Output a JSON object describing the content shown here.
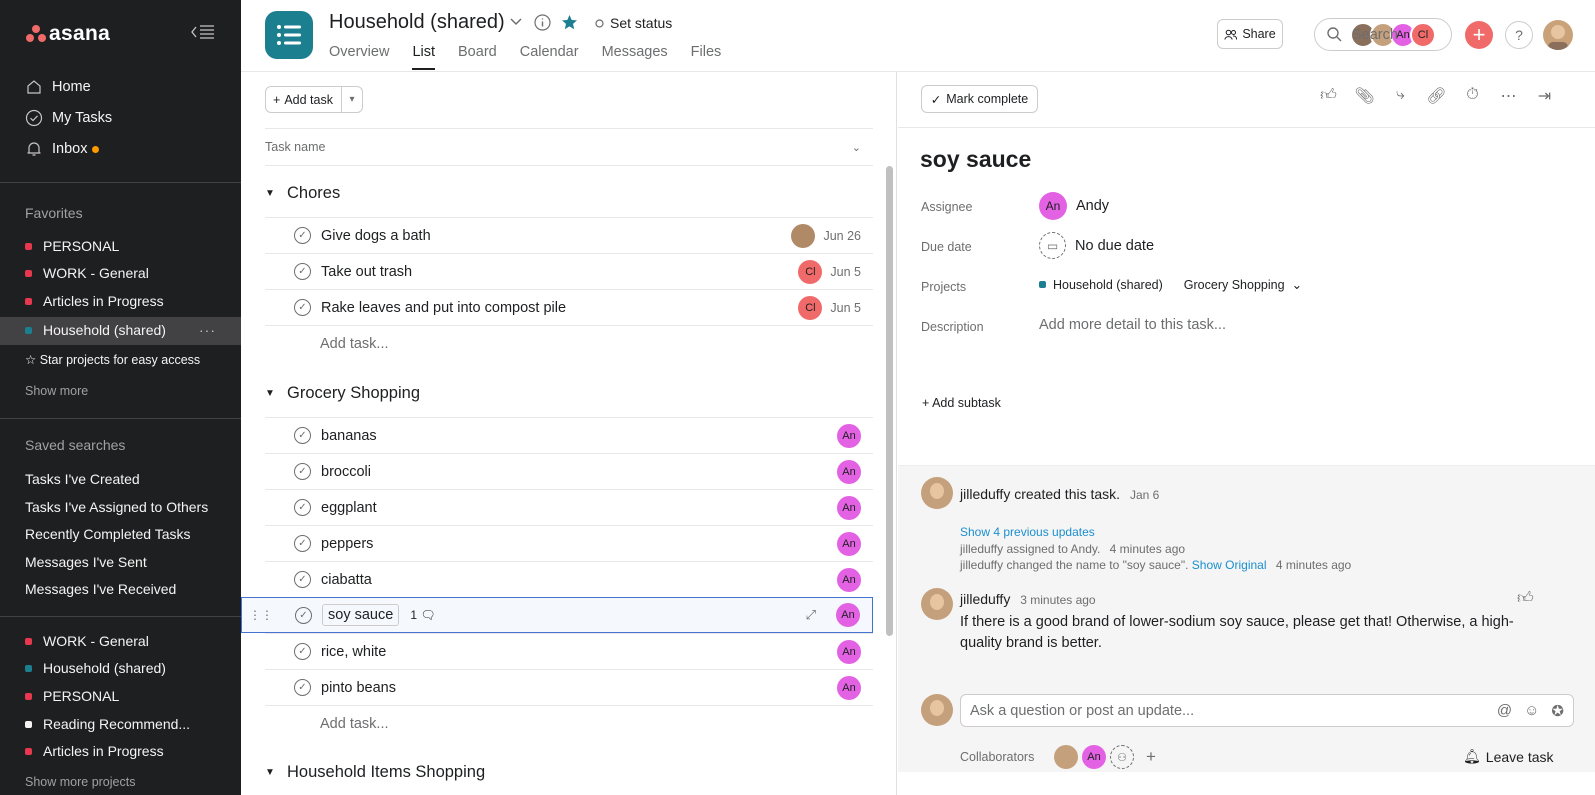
{
  "app": {
    "logo": "asana"
  },
  "sidebar": {
    "nav": [
      {
        "label": "Home",
        "icon": "home-icon"
      },
      {
        "label": "My Tasks",
        "icon": "check-circle-icon"
      },
      {
        "label": "Inbox",
        "icon": "bell-icon"
      }
    ],
    "favorites_title": "Favorites",
    "favorites": [
      {
        "label": "PERSONAL",
        "color": "#e8384f"
      },
      {
        "label": "WORK - General",
        "color": "#e8384f"
      },
      {
        "label": "Articles in Progress",
        "color": "#e8384f"
      },
      {
        "label": "Household (shared)",
        "color": "#1c7f8f"
      }
    ],
    "star_hint": "Star projects for easy access",
    "show_more": "Show more",
    "saved_title": "Saved searches",
    "saved": [
      "Tasks I've Created",
      "Tasks I've Assigned to Others",
      "Recently Completed Tasks",
      "Messages I've Sent",
      "Messages I've Received"
    ],
    "projects": [
      {
        "label": "WORK - General",
        "color": "#e8384f"
      },
      {
        "label": "Household (shared)",
        "color": "#1c7f8f"
      },
      {
        "label": "PERSONAL",
        "color": "#e8384f"
      },
      {
        "label": "Reading Recommend...",
        "color": "#f5f4f3"
      },
      {
        "label": "Articles in Progress",
        "color": "#e8384f"
      }
    ],
    "show_more_projects": "Show more projects"
  },
  "header": {
    "title": "Household (shared)",
    "set_status": "Set status",
    "tabs": [
      "Overview",
      "List",
      "Board",
      "Calendar",
      "Messages",
      "Files"
    ],
    "active_tab": "List",
    "members": [
      "An",
      "Cl"
    ],
    "share": "Share",
    "search_placeholder": "Search",
    "help": "?"
  },
  "list": {
    "add_task": "Add task",
    "column_header": "Task name",
    "sections": [
      {
        "title": "Chores",
        "tasks": [
          {
            "name": "Give dogs a bath",
            "assignee": "",
            "due": "Jun 26"
          },
          {
            "name": "Take out trash",
            "assignee": "Cl",
            "due": "Jun 5"
          },
          {
            "name": "Rake leaves and put into compost pile",
            "assignee": "Cl",
            "due": "Jun 5"
          }
        ]
      },
      {
        "title": "Grocery Shopping",
        "tasks": [
          {
            "name": "bananas",
            "assignee": "An"
          },
          {
            "name": "broccoli",
            "assignee": "An"
          },
          {
            "name": "eggplant",
            "assignee": "An"
          },
          {
            "name": "peppers",
            "assignee": "An"
          },
          {
            "name": "ciabatta",
            "assignee": "An"
          },
          {
            "name": "soy sauce",
            "assignee": "An",
            "comments": "1"
          },
          {
            "name": "rice, white",
            "assignee": "An"
          },
          {
            "name": "pinto beans",
            "assignee": "An"
          }
        ]
      },
      {
        "title": "Household Items Shopping",
        "tasks": []
      }
    ],
    "add_task_row": "Add task..."
  },
  "detail": {
    "mark_complete": "Mark complete",
    "title": "soy sauce",
    "fields": {
      "assignee_label": "Assignee",
      "assignee_initials": "An",
      "assignee_name": "Andy",
      "due_label": "Due date",
      "due_value": "No due date",
      "projects_label": "Projects",
      "project_name": "Household (shared)",
      "project_section": "Grocery Shopping",
      "description_label": "Description",
      "description_placeholder": "Add more detail to this task..."
    },
    "add_subtask": "Add subtask",
    "activity": {
      "created_by": "jilleduffy created this task.",
      "created_date": "Jan 6",
      "show_previous": "Show 4 previous updates",
      "update1_user": "jilleduffy",
      "update1_text": "assigned to Andy.",
      "update1_time": "4 minutes ago",
      "update2_user": "jilleduffy",
      "update2_text": "changed the name to \"soy sauce\".",
      "update2_link": "Show Original",
      "update2_time": "4 minutes ago",
      "comment_user": "jilleduffy",
      "comment_time": "3 minutes ago",
      "comment_text": "If there is a good brand of lower-sodium soy sauce, please get that! Otherwise, a high-quality brand is better."
    },
    "comment_placeholder": "Ask a question or post an update...",
    "collaborators_label": "Collaborators",
    "collaborator_initials": "An",
    "leave_task": "Leave task"
  },
  "colors": {
    "accent": "#f06a6a",
    "project_teal": "#1c7f8f",
    "link": "#1a8fcf",
    "avatar_pink": "#e362e3"
  }
}
